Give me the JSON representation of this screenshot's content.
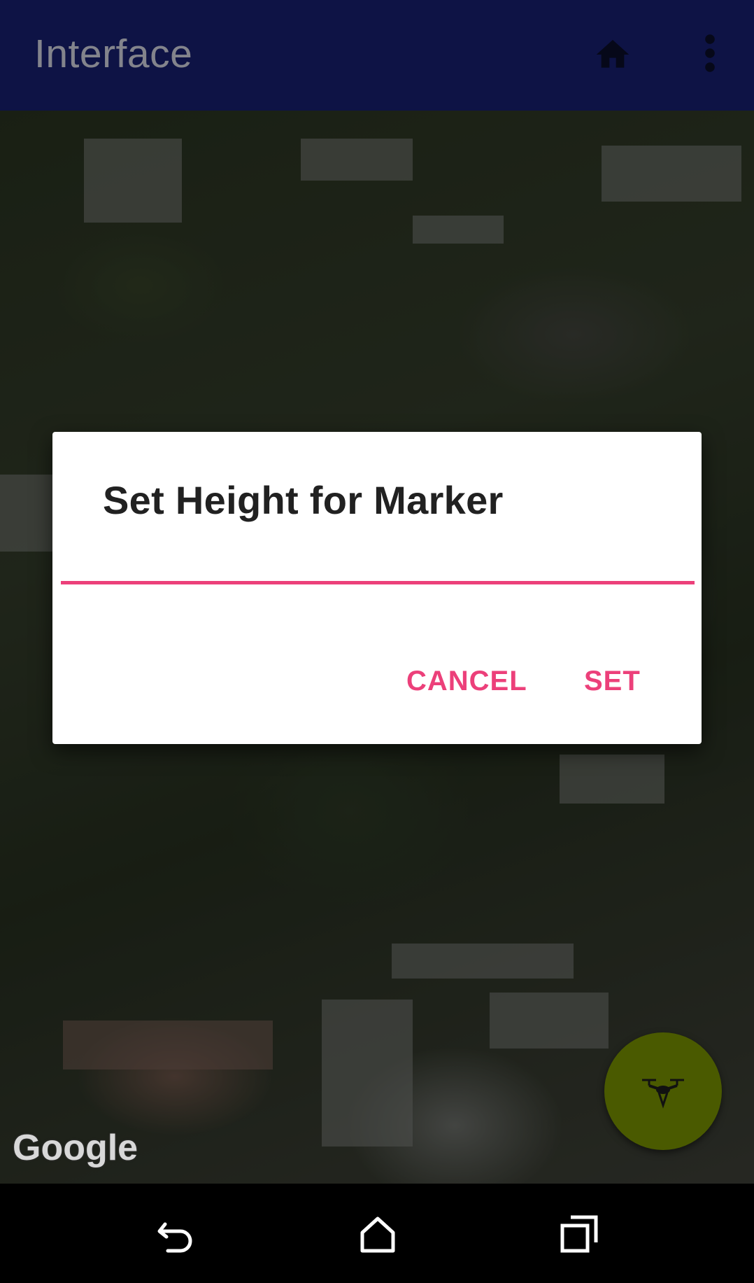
{
  "app_bar": {
    "title": "Interface",
    "background": "#1a237e",
    "home_icon": "home-icon",
    "more_icon": "more-vert-icon"
  },
  "map": {
    "attribution": "Google",
    "type": "satellite"
  },
  "dialog": {
    "title": "Set Height for Marker",
    "input_value": "",
    "accent": "#ec407a",
    "cancel_label": "CANCEL",
    "set_label": "SET"
  },
  "fab": {
    "icon": "drone-icon",
    "background": "#4a5a00"
  },
  "nav_bar": {
    "back_icon": "back-icon",
    "home_icon": "home-outline-icon",
    "recents_icon": "recents-icon"
  }
}
